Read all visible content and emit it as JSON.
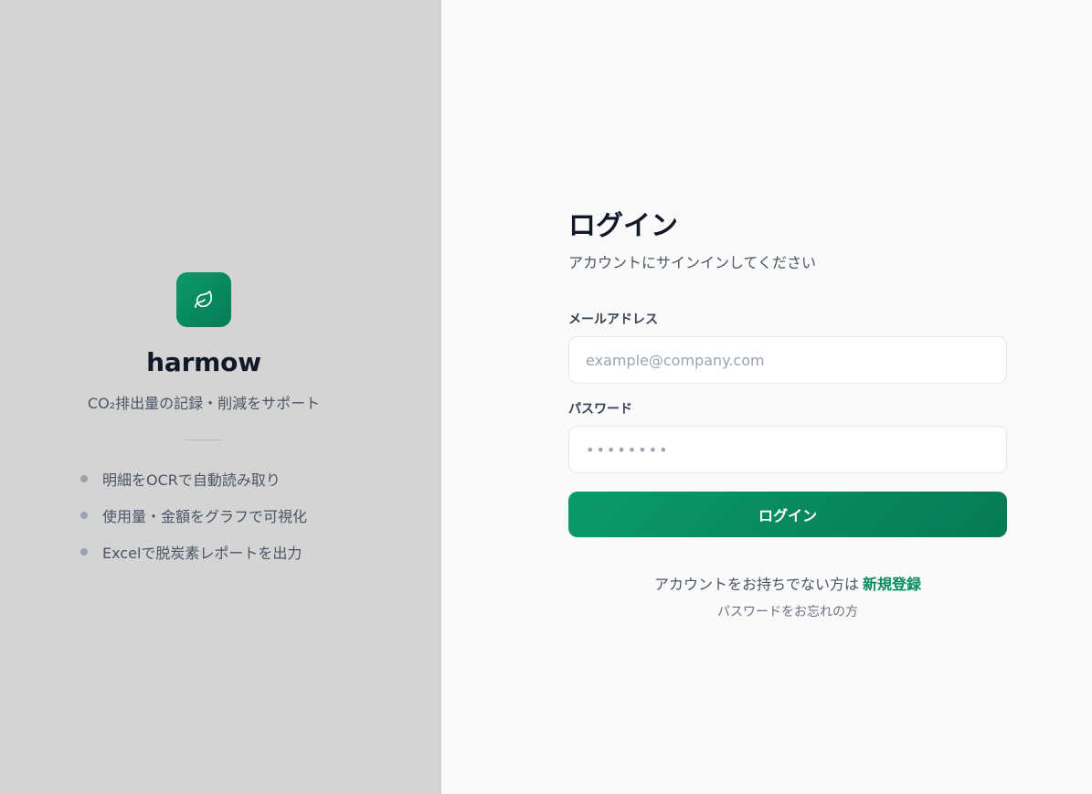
{
  "brand": {
    "name": "harmow",
    "tagline": "CO₂排出量の記録・削減をサポート",
    "logo_icon": "leaf-icon",
    "accent_color": "#0b9a6a"
  },
  "features": [
    {
      "label": "明細をOCRで自動読み取り"
    },
    {
      "label": "使用量・金額をグラフで可視化"
    },
    {
      "label": "Excelで脱炭素レポートを出力"
    }
  ],
  "login": {
    "title": "ログイン",
    "subtitle": "アカウントにサインインしてください",
    "email_label": "メールアドレス",
    "email_value": "",
    "email_placeholder": "example@company.com",
    "password_label": "パスワード",
    "password_value": "",
    "password_placeholder": "••••••••",
    "submit_label": "ログイン",
    "no_account_text": "アカウントをお持ちでない方は",
    "signup_label": "新規登録",
    "forgot_label": "パスワードをお忘れの方"
  }
}
